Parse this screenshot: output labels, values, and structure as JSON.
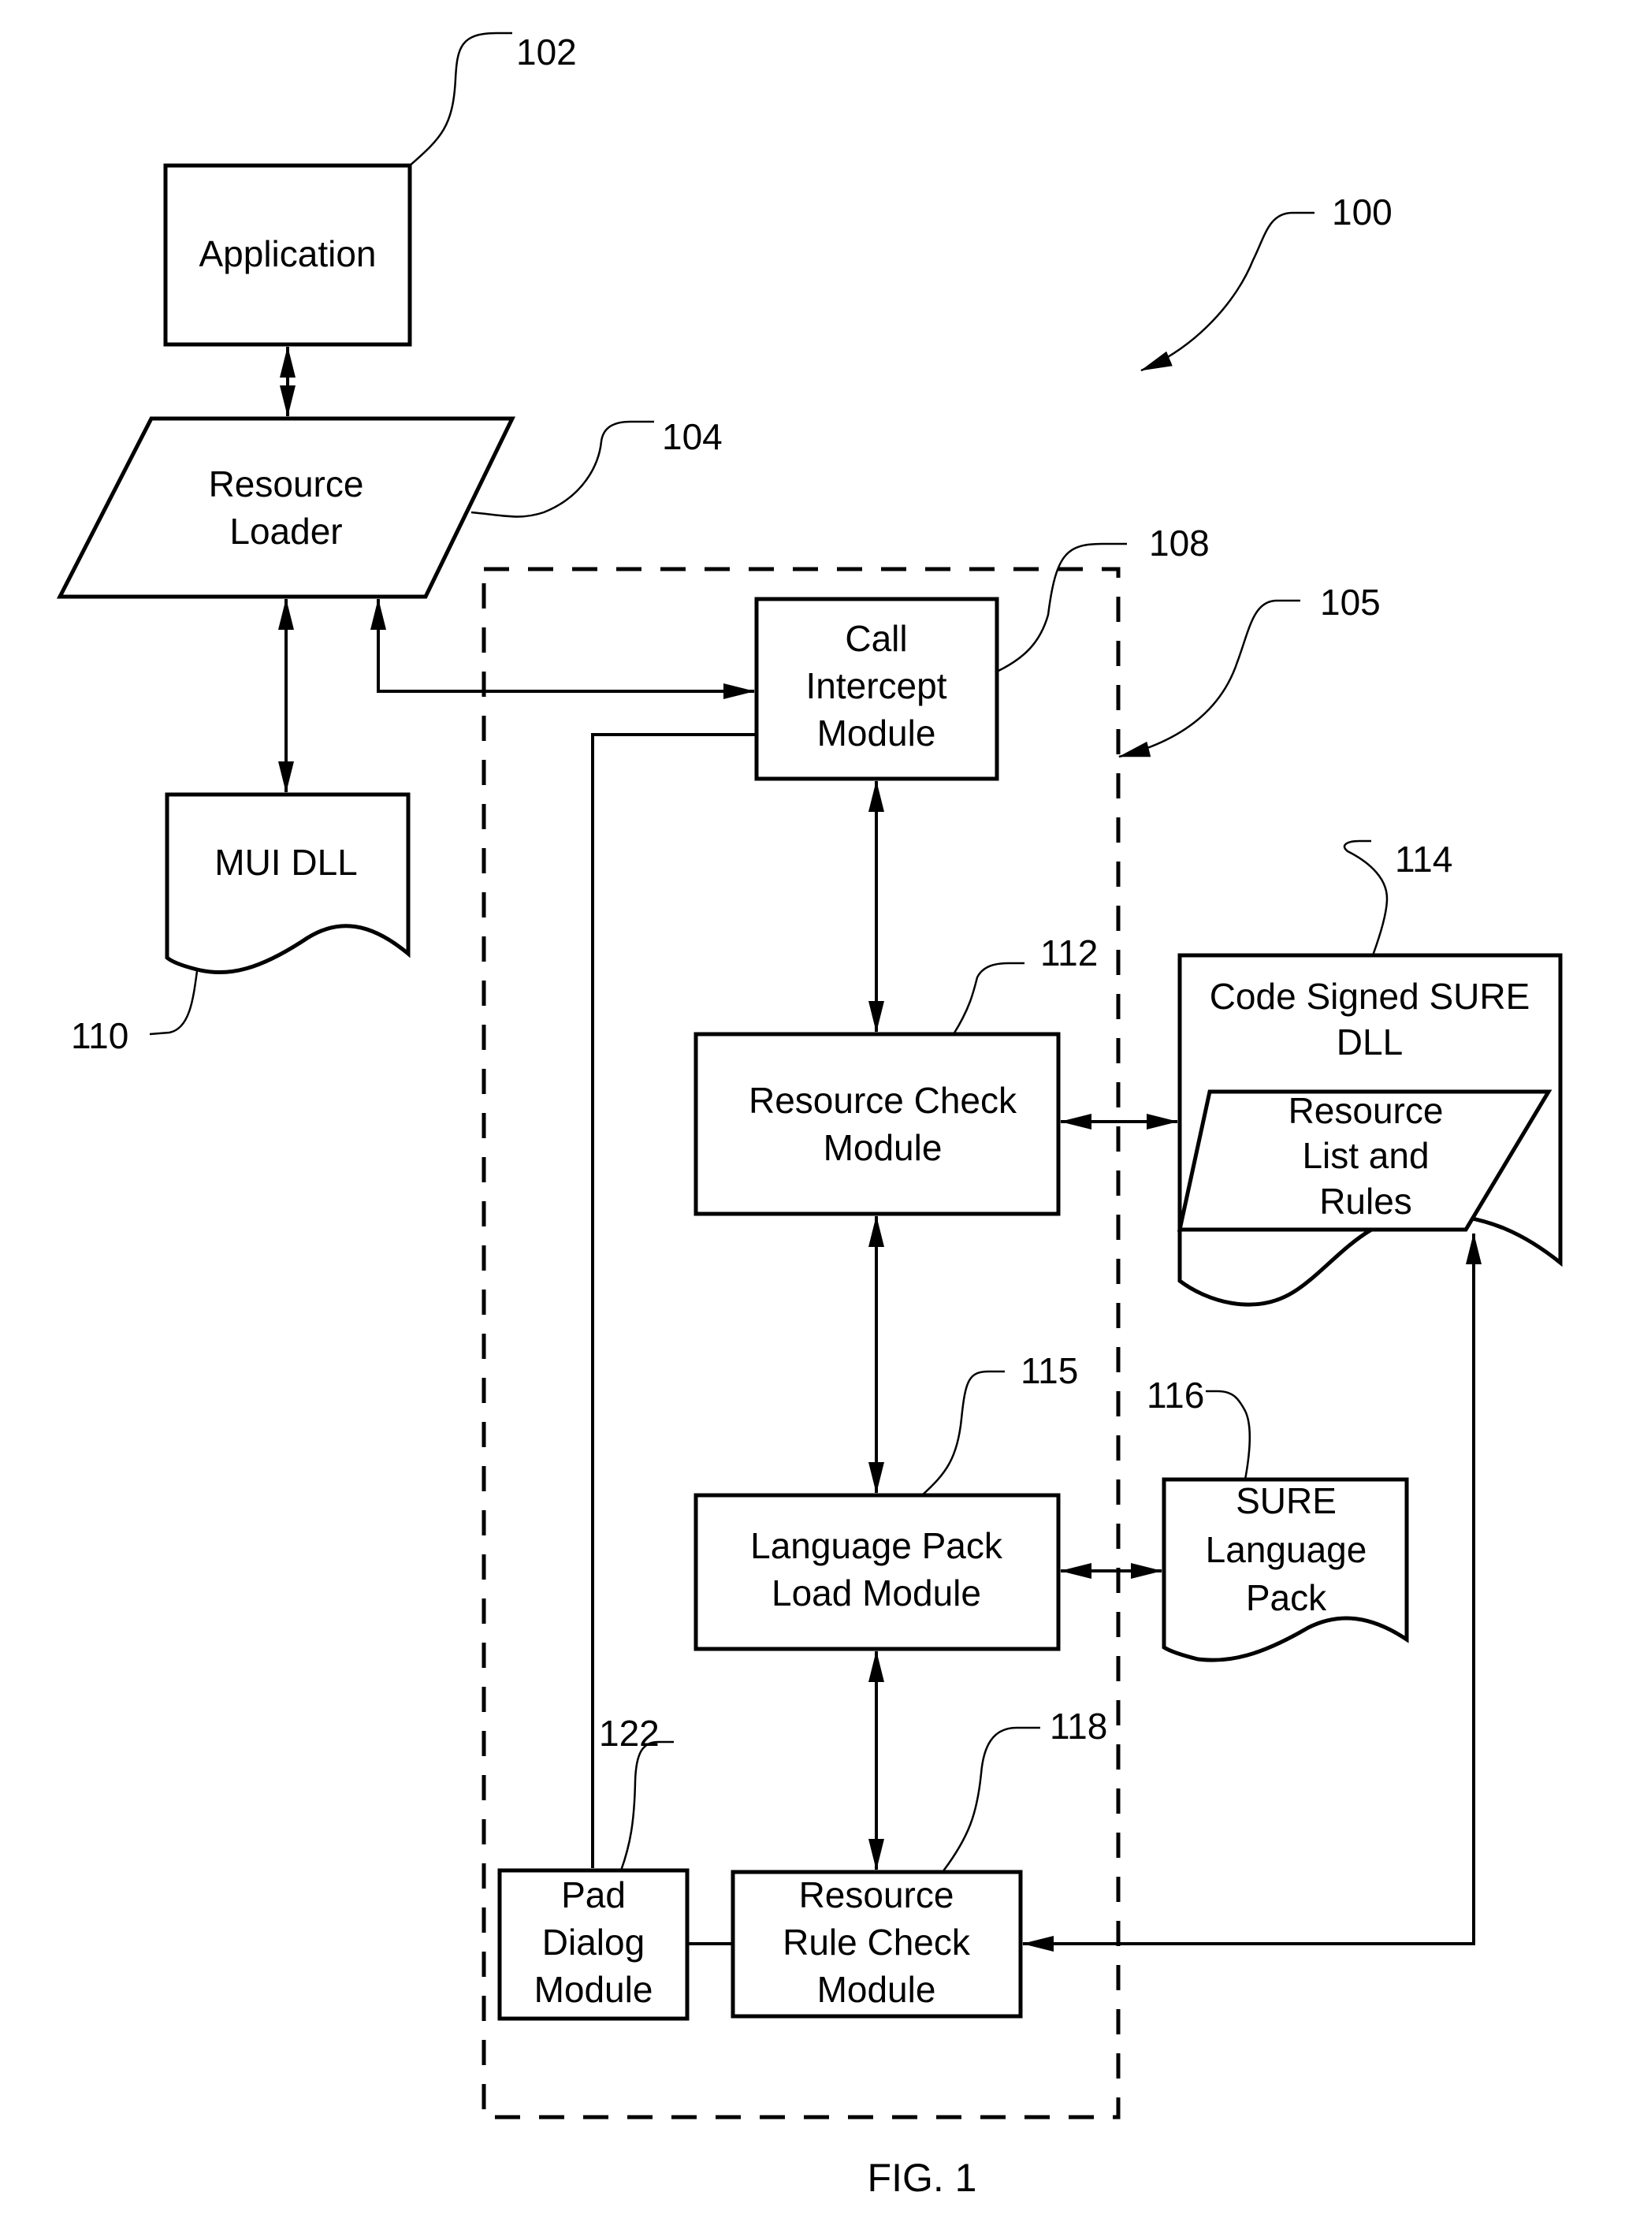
{
  "figure": {
    "caption": "FIG. 1",
    "system_ref": "100",
    "group_ref": "105"
  },
  "nodes": {
    "application": {
      "ref": "102",
      "lines": [
        "Application"
      ]
    },
    "resource_loader": {
      "ref": "104",
      "lines": [
        "Resource",
        "Loader"
      ]
    },
    "call_intercept": {
      "ref": "108",
      "lines": [
        "Call",
        "Intercept",
        "Module"
      ]
    },
    "mui_dll": {
      "ref": "110",
      "lines": [
        "MUI DLL"
      ]
    },
    "resource_check": {
      "ref": "112",
      "lines": [
        "Resource Check",
        "Module"
      ]
    },
    "sure_dll": {
      "ref": "114",
      "lines": [
        "Code Signed SURE",
        "DLL"
      ]
    },
    "resource_list": {
      "lines": [
        "Resource",
        "List and",
        "Rules"
      ]
    },
    "lang_pack_load": {
      "ref": "115",
      "lines": [
        "Language Pack",
        "Load Module"
      ]
    },
    "sure_lang_pack": {
      "ref": "116",
      "lines": [
        "SURE",
        "Language",
        "Pack"
      ]
    },
    "rule_check": {
      "ref": "118",
      "lines": [
        "Resource",
        "Rule Check",
        "Module"
      ]
    },
    "pad_dialog": {
      "ref": "122",
      "lines": [
        "Pad",
        "Dialog",
        "Module"
      ]
    }
  },
  "edges": [
    {
      "from": "application",
      "to": "resource_loader",
      "arrows": "both"
    },
    {
      "from": "resource_loader",
      "to": "mui_dll",
      "arrows": "both"
    },
    {
      "from": "resource_loader",
      "to": "call_intercept",
      "arrows": "both"
    },
    {
      "from": "call_intercept",
      "to": "pad_dialog",
      "arrows": "none"
    },
    {
      "from": "call_intercept",
      "to": "resource_check",
      "arrows": "both"
    },
    {
      "from": "resource_check",
      "to": "sure_dll",
      "arrows": "both"
    },
    {
      "from": "resource_check",
      "to": "lang_pack_load",
      "arrows": "both"
    },
    {
      "from": "lang_pack_load",
      "to": "sure_lang_pack",
      "arrows": "both"
    },
    {
      "from": "lang_pack_load",
      "to": "rule_check",
      "arrows": "both"
    },
    {
      "from": "pad_dialog",
      "to": "rule_check",
      "arrows": "none"
    },
    {
      "from": "sure_dll",
      "to": "rule_check",
      "arrows": "both"
    }
  ]
}
